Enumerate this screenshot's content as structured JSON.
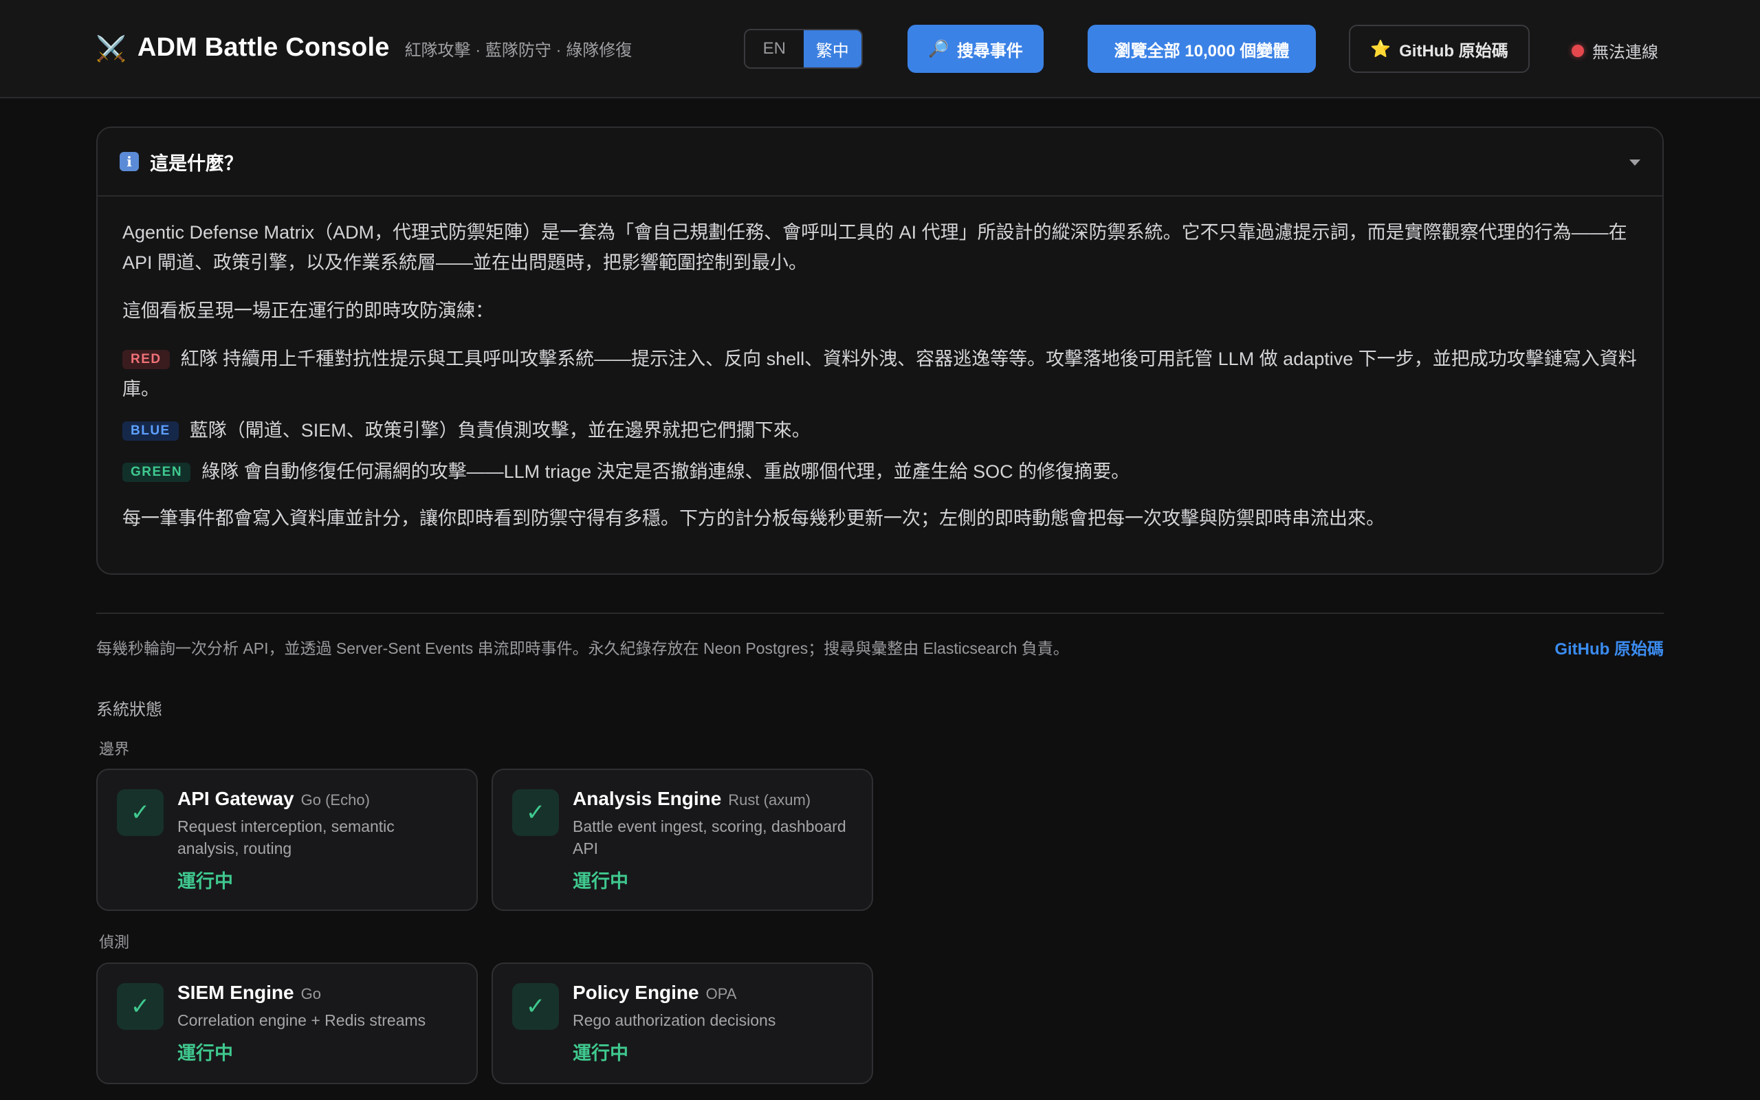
{
  "header": {
    "brand_icon": "⚔️",
    "title": "ADM Battle Console",
    "subtitle": "紅隊攻擊 · 藍隊防守 · 綠隊修復",
    "lang": {
      "en": "EN",
      "zh": "繁中",
      "active": "繁中"
    },
    "search_icon": "🔎",
    "search_label": "搜尋事件",
    "browse_label": "瀏覽全部 10,000 個變體",
    "github_icon": "⭐",
    "github_label": "GitHub 原始碼",
    "connection_status": "無法連線",
    "connection_color": "#e5484d"
  },
  "info_panel": {
    "icon": "i",
    "title": "這是什麼？",
    "intro": "Agentic Defense Matrix（ADM，代理式防禦矩陣）是一套為「會自己規劃任務、會呼叫工具的 AI 代理」所設計的縱深防禦系統。它不只靠過濾提示詞，而是實際觀察代理的行為——在 API 閘道、政策引擎，以及作業系統層——並在出問題時，把影響範圍控制到最小。",
    "lead": "這個看板呈現一場正在運行的即時攻防演練：",
    "teams": [
      {
        "tag": "RED",
        "text": "紅隊 持續用上千種對抗性提示與工具呼叫攻擊系統——提示注入、反向 shell、資料外洩、容器逃逸等等。攻擊落地後可用託管 LLM 做 adaptive 下一步，並把成功攻擊鏈寫入資料庫。"
      },
      {
        "tag": "BLUE",
        "text": "藍隊（閘道、SIEM、政策引擎）負責偵測攻擊，並在邊界就把它們攔下來。"
      },
      {
        "tag": "GREEN",
        "text": "綠隊 會自動修復任何漏網的攻擊——LLM triage 決定是否撤銷連線、重啟哪個代理，並產生給 SOC 的修復摘要。"
      }
    ],
    "closing": "每一筆事件都會寫入資料庫並計分，讓你即時看到防禦守得有多穩。下方的計分板每幾秒更新一次；左側的即時動態會把每一次攻擊與防禦即時串流出來。"
  },
  "footer": {
    "note": "每幾秒輪詢一次分析 API，並透過 Server-Sent Events 串流即時事件。永久紀錄存放在 Neon Postgres；搜尋與彙整由 Elasticsearch 負責。",
    "link": "GitHub 原始碼"
  },
  "status": {
    "title": "系統狀態",
    "groups": [
      {
        "label": "邊界",
        "cards": [
          {
            "name": "API Gateway",
            "tech": "Go (Echo)",
            "desc": "Request interception, semantic analysis, routing",
            "status": "運行中"
          },
          {
            "name": "Analysis Engine",
            "tech": "Rust (axum)",
            "desc": "Battle event ingest, scoring, dashboard API",
            "status": "運行中"
          }
        ]
      },
      {
        "label": "偵測",
        "cards": [
          {
            "name": "SIEM Engine",
            "tech": "Go",
            "desc": "Correlation engine + Redis streams",
            "status": "運行中"
          },
          {
            "name": "Policy Engine",
            "tech": "OPA",
            "desc": "Rego authorization decisions",
            "status": "運行中"
          }
        ]
      }
    ]
  }
}
